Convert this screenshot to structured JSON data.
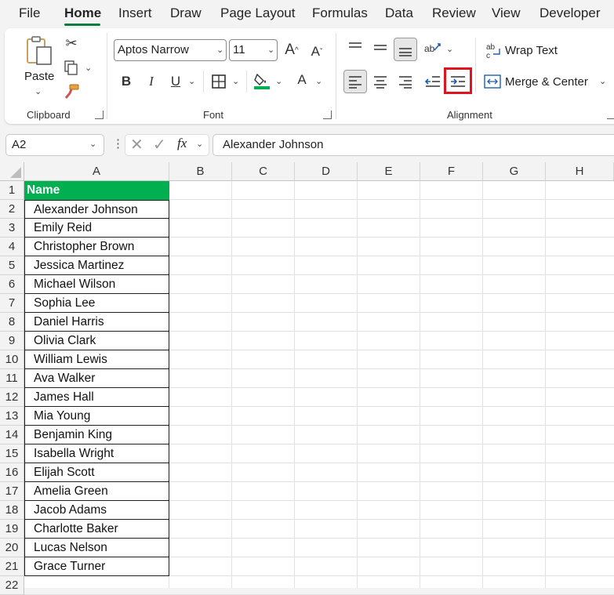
{
  "menu": [
    "File",
    "Home",
    "Insert",
    "Draw",
    "Page Layout",
    "Formulas",
    "Data",
    "Review",
    "View",
    "Developer"
  ],
  "ribbon": {
    "clipboard": {
      "paste_label": "Paste",
      "group_label": "Clipboard"
    },
    "font": {
      "font_name": "Aptos Narrow",
      "font_size": "11",
      "bold": "B",
      "italic": "I",
      "underline": "U",
      "font_color_glyph": "A",
      "group_label": "Font",
      "grow": "A",
      "shrink": "A"
    },
    "alignment": {
      "wrap_text": "Wrap Text",
      "merge_center": "Merge & Center",
      "group_label": "Alignment"
    }
  },
  "formula_bar": {
    "name_box": "A2",
    "fx": "fx",
    "value": "Alexander Johnson"
  },
  "columns": [
    "A",
    "B",
    "C",
    "D",
    "E",
    "F",
    "G",
    "H"
  ],
  "rows": [
    "1",
    "2",
    "3",
    "4",
    "5",
    "6",
    "7",
    "8",
    "9",
    "10",
    "11",
    "12",
    "13",
    "14",
    "15",
    "16",
    "17",
    "18",
    "19",
    "20",
    "21",
    "22"
  ],
  "table": {
    "header": "Name",
    "header_color": "#00b050",
    "names": [
      "Alexander Johnson",
      "Emily Reid",
      "Christopher Brown",
      "Jessica Martinez",
      "Michael Wilson",
      "Sophia Lee",
      "Daniel Harris",
      "Olivia Clark",
      "William Lewis",
      "Ava Walker",
      "James Hall",
      "Mia Young",
      "Benjamin King",
      "Isabella Wright",
      "Elijah Scott",
      "Amelia Green",
      "Jacob Adams",
      "Charlotte Baker",
      "Lucas Nelson",
      "Grace Turner"
    ]
  },
  "highlighted_button": "increase-indent",
  "accent_color": "#0f7b3f"
}
